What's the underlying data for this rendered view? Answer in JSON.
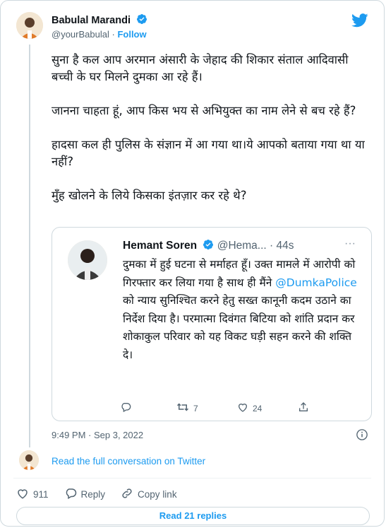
{
  "colors": {
    "accent": "#1d9bf0",
    "text": "#0f1419",
    "muted": "#536471",
    "border": "#cfd9de"
  },
  "author": {
    "name": "Babulal Marandi",
    "handle": "@yourBabulal",
    "separator": "·",
    "follow_label": "Follow"
  },
  "tweet": {
    "paragraphs": [
      "सुना है कल आप अरमान अंसारी के जेहाद की शिकार संताल आदिवासी बच्ची के घर मिलने दुमका आ रहे हैं।",
      "जानना चाहता हूं, आप किस भय से अभियुक्त का नाम लेने से बच रहे हैं?",
      "हादसा कल ही पुलिस के संज्ञान में आ गया था।ये आपको बताया गया था या नहीं?",
      "मुँह खोलने के लिये किसका इंतज़ार कर रहे थे?"
    ],
    "timestamp": "9:49 PM · Sep 3, 2022"
  },
  "quote": {
    "name": "Hemant Soren",
    "handle": "@Hema...",
    "time": "· 44s",
    "more": "···",
    "text_before": "दुमका में हुई घटना से मर्माहत हूँ। उक्त मामले में आरोपी को गिरफ्तार कर लिया गया है साथ ही मैंने ",
    "mention": "@DumkaPolice",
    "text_after": " को न्याय सुनिश्चित करने हेतु सख्त कानूनी कदम उठाने का निर्देश दिया है। परमात्मा दिवंगत बिटिया को शांति प्रदान कर शोकाकुल परिवार को यह विकट घड़ी सहन करने की शक्ति दे।",
    "retweets": "7",
    "likes": "24"
  },
  "footer": {
    "read_full": "Read the full conversation on Twitter",
    "likes": "911",
    "reply_label": "Reply",
    "copy_link_label": "Copy link",
    "read_replies": "Read 21 replies"
  },
  "icons": [
    "twitter-bird-icon",
    "verified-badge-icon",
    "reply-icon",
    "retweet-icon",
    "heart-icon",
    "share-icon",
    "info-icon",
    "link-icon"
  ]
}
